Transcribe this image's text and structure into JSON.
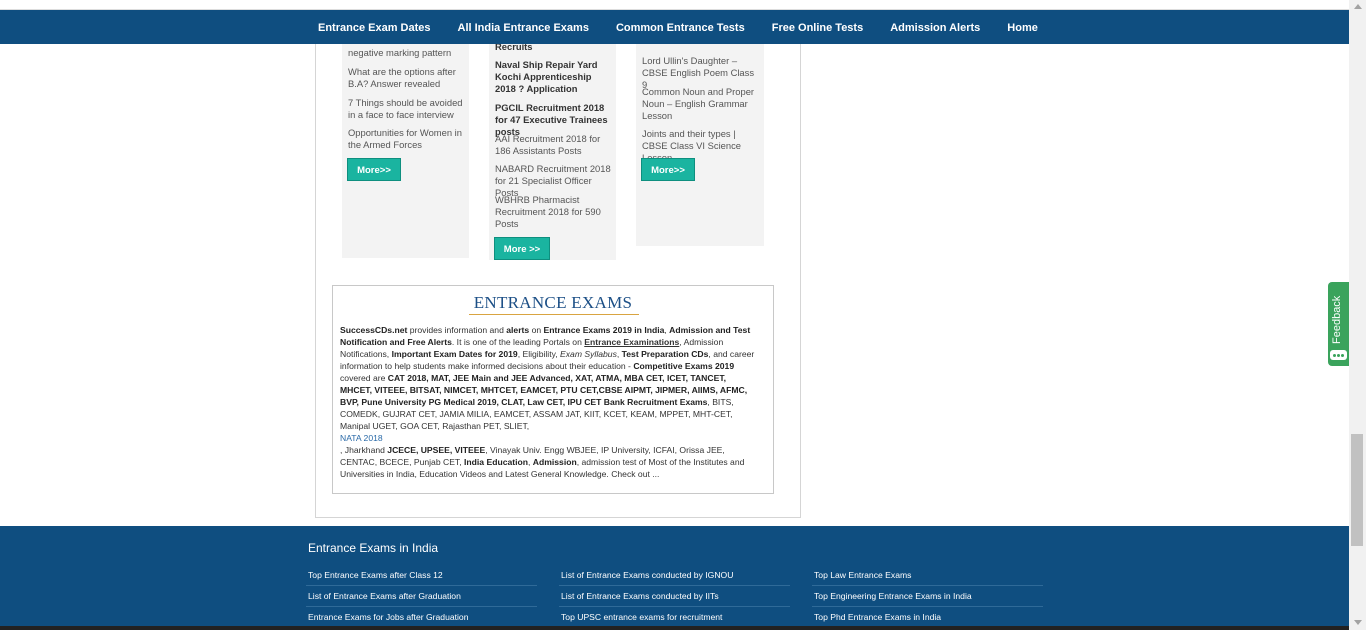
{
  "nav": {
    "items": [
      "Entrance Exam Dates",
      "All India Entrance Exams",
      "Common Entrance Tests",
      "Free Online Tests",
      "Admission Alerts",
      "Home"
    ]
  },
  "col1": {
    "items": [
      "negative marking pattern",
      "What are the options after B.A? Answer revealed",
      "7 Things should be avoided in a face to face interview",
      "Opportunities for Women in the Armed Forces"
    ],
    "more": "More>>"
  },
  "col2": {
    "items": [
      "Recruits",
      "Naval Ship Repair Yard Kochi Apprenticeship 2018 ? Application",
      "PGCIL Recruitment 2018 for 47 Executive Trainees posts",
      "AAI Recruitment 2018 for 186 Assistants Posts",
      "NABARD Recruitment 2018 for 21 Specialist Officer Posts",
      "WBHRB Pharmacist Recruitment 2018 for 590 Posts"
    ],
    "more": "More >>"
  },
  "col3": {
    "items": [
      "Lord Ullin's Daughter – CBSE English Poem Class 9",
      "Common Noun and Proper Noun – English Grammar Lesson",
      "Joints and their types | CBSE Class VI Science Lesson"
    ],
    "more": "More>>"
  },
  "exams": {
    "title": "ENTRANCE EXAMS",
    "p1": "SuccessCDs.net",
    "p2": " provides information and ",
    "p3": "alerts",
    "p4": " on ",
    "p5": "Entrance Exams 2019 in India",
    "p6": ", ",
    "p7": "Admission and Test Notification and Free Alerts",
    "p8": ". It is one of the leading Portals on ",
    "p9": "Entrance Examinations",
    "p10": ", Admission Notifications, ",
    "p11": "Important Exam Dates for 2019",
    "p12": ", Eligibility, ",
    "p13": "Exam Syllabus",
    "p14": ", ",
    "p15": "Test Preparation CDs",
    "p16": ", and career information to help students make informed decisions about their education - ",
    "p17": "Competitive Exams 2019",
    "p18": " covered are ",
    "p19": "CAT 2018, MAT, JEE Main and JEE Advanced, XAT, ATMA, MBA CET, ICET, TANCET, MHCET, VITEEE, BITSAT, NIMCET, MHTCET, EAMCET, PTU CET,CBSE AIPMT, JIPMER, AIIMS, AFMC, BVP, Pune University PG Medical 2019, CLAT, Law CET, IPU CET Bank Recruitment Exams",
    "p20": ", BITS, COMEDK, GUJRAT CET, JAMIA MILIA, EAMCET, ASSAM JAT, KIIT, KCET, KEAM, MPPET, MHT-CET, Manipal UGET, GOA CET, Rajasthan PET, SLIET,",
    "link": "NATA 2018",
    "p21": ", Jharkhand ",
    "p22": "JCECE, UPSEE, VITEEE",
    "p23": ", Vinayak Univ. Engg WBJEE, IP University, ICFAI, Orissa JEE, CENTAC, BCECE, Punjab CET, ",
    "p24": "India Education",
    "p25": ", ",
    "p26": "Admission",
    "p27": ", admission test of Most of the Institutes and Universities in India, Education Videos and Latest General Knowledge. Check out ..."
  },
  "footer": {
    "title": "Entrance Exams in India",
    "col1": [
      "Top Entrance Exams after Class 12",
      "List of Entrance Exams after Graduation",
      "Entrance Exams for Jobs after Graduation"
    ],
    "col2": [
      "List of Entrance Exams conducted by IGNOU",
      "List of Entrance Exams conducted by IITs",
      "Top UPSC entrance exams for recruitment"
    ],
    "col3": [
      "Top Law Entrance Exams",
      "Top Engineering Entrance Exams in India",
      "Top Phd Entrance Exams in India"
    ]
  },
  "feedback": {
    "label": "Feedback"
  },
  "colors": {
    "nav_bg": "#0f4e80",
    "button": "#1ab4a0",
    "title": "#1c4f86",
    "feedback": "#3aa35c"
  }
}
